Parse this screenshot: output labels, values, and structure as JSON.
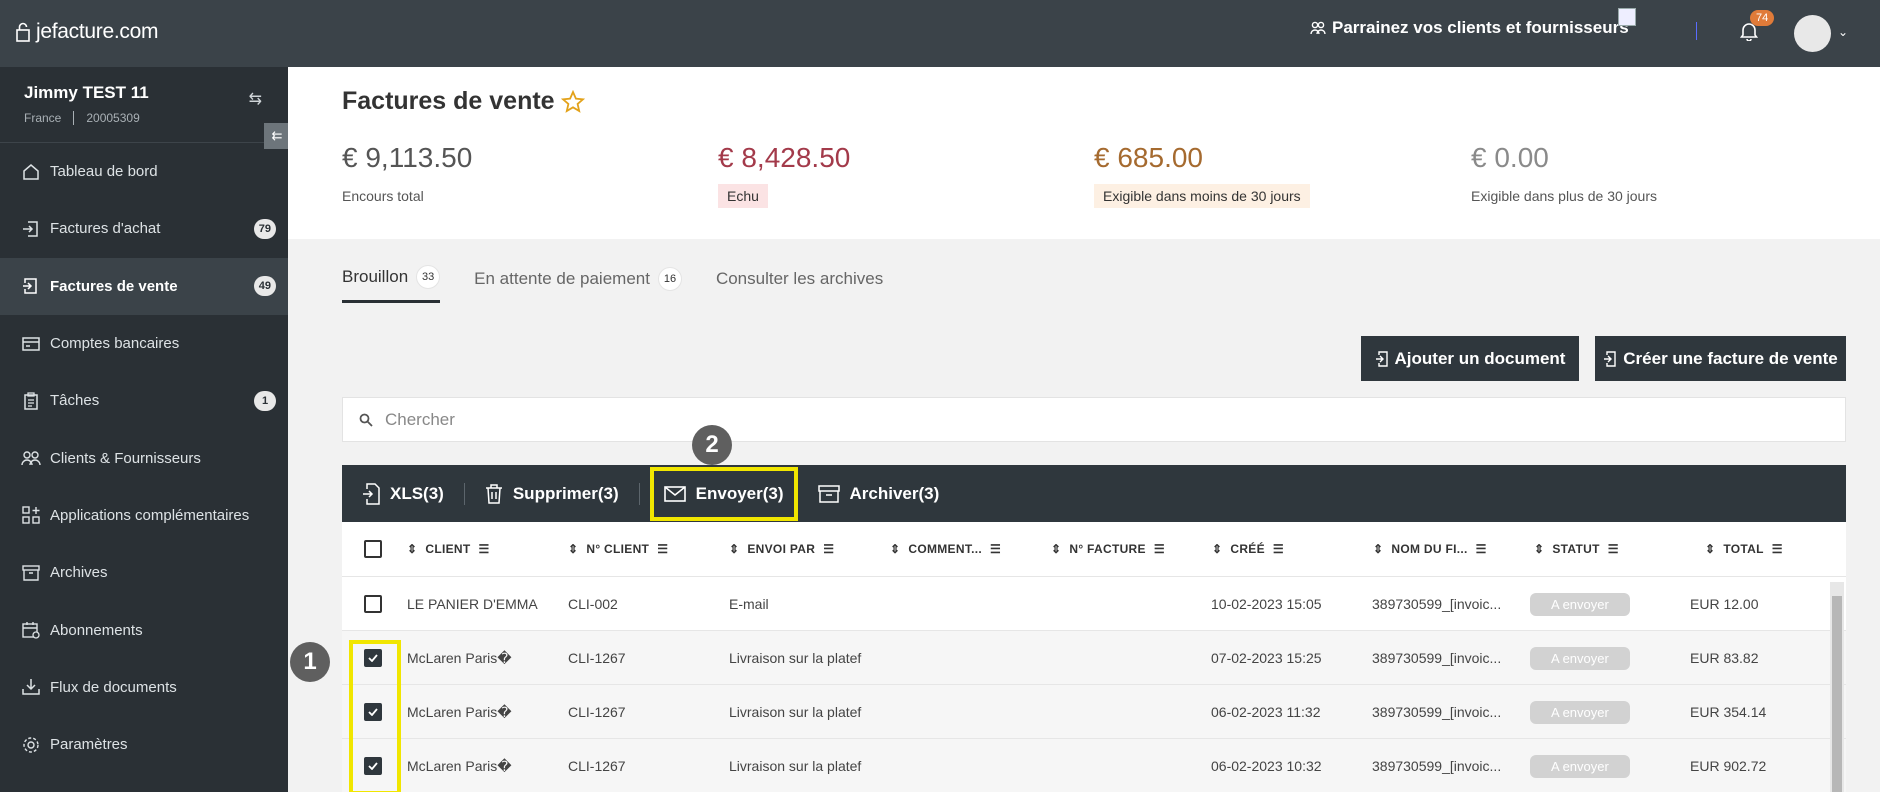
{
  "app": {
    "logo_text": "jefacture.com",
    "referral_text": "Parrainez vos clients et fournisseurs",
    "notifications_count": "74"
  },
  "sidebar": {
    "org_name": "Jimmy TEST 11",
    "org_country": "France",
    "org_id": "20005309",
    "items": [
      {
        "label": "Tableau de bord",
        "icon": "home-icon",
        "badge": ""
      },
      {
        "label": "Factures d'achat",
        "icon": "purchase-invoice-icon",
        "badge": "79"
      },
      {
        "label": "Factures de vente",
        "icon": "sales-invoice-icon",
        "badge": "49"
      },
      {
        "label": "Comptes bancaires",
        "icon": "bank-card-icon",
        "badge": ""
      },
      {
        "label": "Tâches",
        "icon": "clipboard-icon",
        "badge": "1"
      },
      {
        "label": "Clients & Fournisseurs",
        "icon": "users-icon",
        "badge": ""
      },
      {
        "label": "Applications complémentaires",
        "icon": "apps-icon",
        "badge": ""
      },
      {
        "label": "Archives",
        "icon": "archive-icon",
        "badge": ""
      },
      {
        "label": "Abonnements",
        "icon": "calendar-icon",
        "badge": ""
      },
      {
        "label": "Flux de documents",
        "icon": "download-icon",
        "badge": ""
      },
      {
        "label": "Paramètres",
        "icon": "gear-icon",
        "badge": ""
      }
    ]
  },
  "page": {
    "title": "Factures de vente",
    "kpis": [
      {
        "amount": "€ 9,113.50",
        "label": "Encours total",
        "color": "#555555"
      },
      {
        "amount": "€ 8,428.50",
        "label": "Echu",
        "color": "#a33a4a"
      },
      {
        "amount": "€ 685.00",
        "label": "Exigible dans moins de 30 jours",
        "color": "#a56a2f"
      },
      {
        "amount": "€ 0.00",
        "label": "Exigible dans plus de 30 jours",
        "color": "#8a8a8a"
      }
    ],
    "tabs": [
      {
        "label": "Brouillon",
        "count": "33"
      },
      {
        "label": "En attente de paiement",
        "count": "16"
      },
      {
        "label": "Consulter les archives",
        "count": ""
      }
    ],
    "buttons": {
      "add_document": "Ajouter un document",
      "create_invoice": "Créer une facture de vente"
    },
    "search_placeholder": "Chercher",
    "actions": {
      "xls": "XLS(3)",
      "delete": "Supprimer(3)",
      "send": "Envoyer(3)",
      "archive": "Archiver(3)"
    },
    "step_badges": {
      "one": "1",
      "two": "2"
    }
  },
  "table": {
    "columns": [
      "CLIENT",
      "N° CLIENT",
      "ENVOI PAR",
      "COMMENT...",
      "N° FACTURE",
      "CRÉÉ",
      "NOM DU FI...",
      "STATUT",
      "TOTAL"
    ],
    "rows": [
      {
        "checked": false,
        "client": "LE PANIER D'EMMA",
        "client_no": "CLI-002",
        "sent_by": "E-mail",
        "created": "10-02-2023 15:05",
        "file_name": "389730599_[invoic...",
        "status": "A envoyer",
        "total": "EUR 12.00"
      },
      {
        "checked": true,
        "client": "McLaren Paris�",
        "client_no": "CLI-1267",
        "sent_by": "Livraison sur la platef",
        "created": "07-02-2023 15:25",
        "file_name": "389730599_[invoic...",
        "status": "A envoyer",
        "total": "EUR 83.82"
      },
      {
        "checked": true,
        "client": "McLaren Paris�",
        "client_no": "CLI-1267",
        "sent_by": "Livraison sur la platef",
        "created": "06-02-2023 11:32",
        "file_name": "389730599_[invoic...",
        "status": "A envoyer",
        "total": "EUR 354.14"
      },
      {
        "checked": true,
        "client": "McLaren Paris�",
        "client_no": "CLI-1267",
        "sent_by": "Livraison sur la platef",
        "created": "06-02-2023 10:32",
        "file_name": "389730599_[invoic...",
        "status": "A envoyer",
        "total": "EUR 902.72"
      }
    ]
  }
}
